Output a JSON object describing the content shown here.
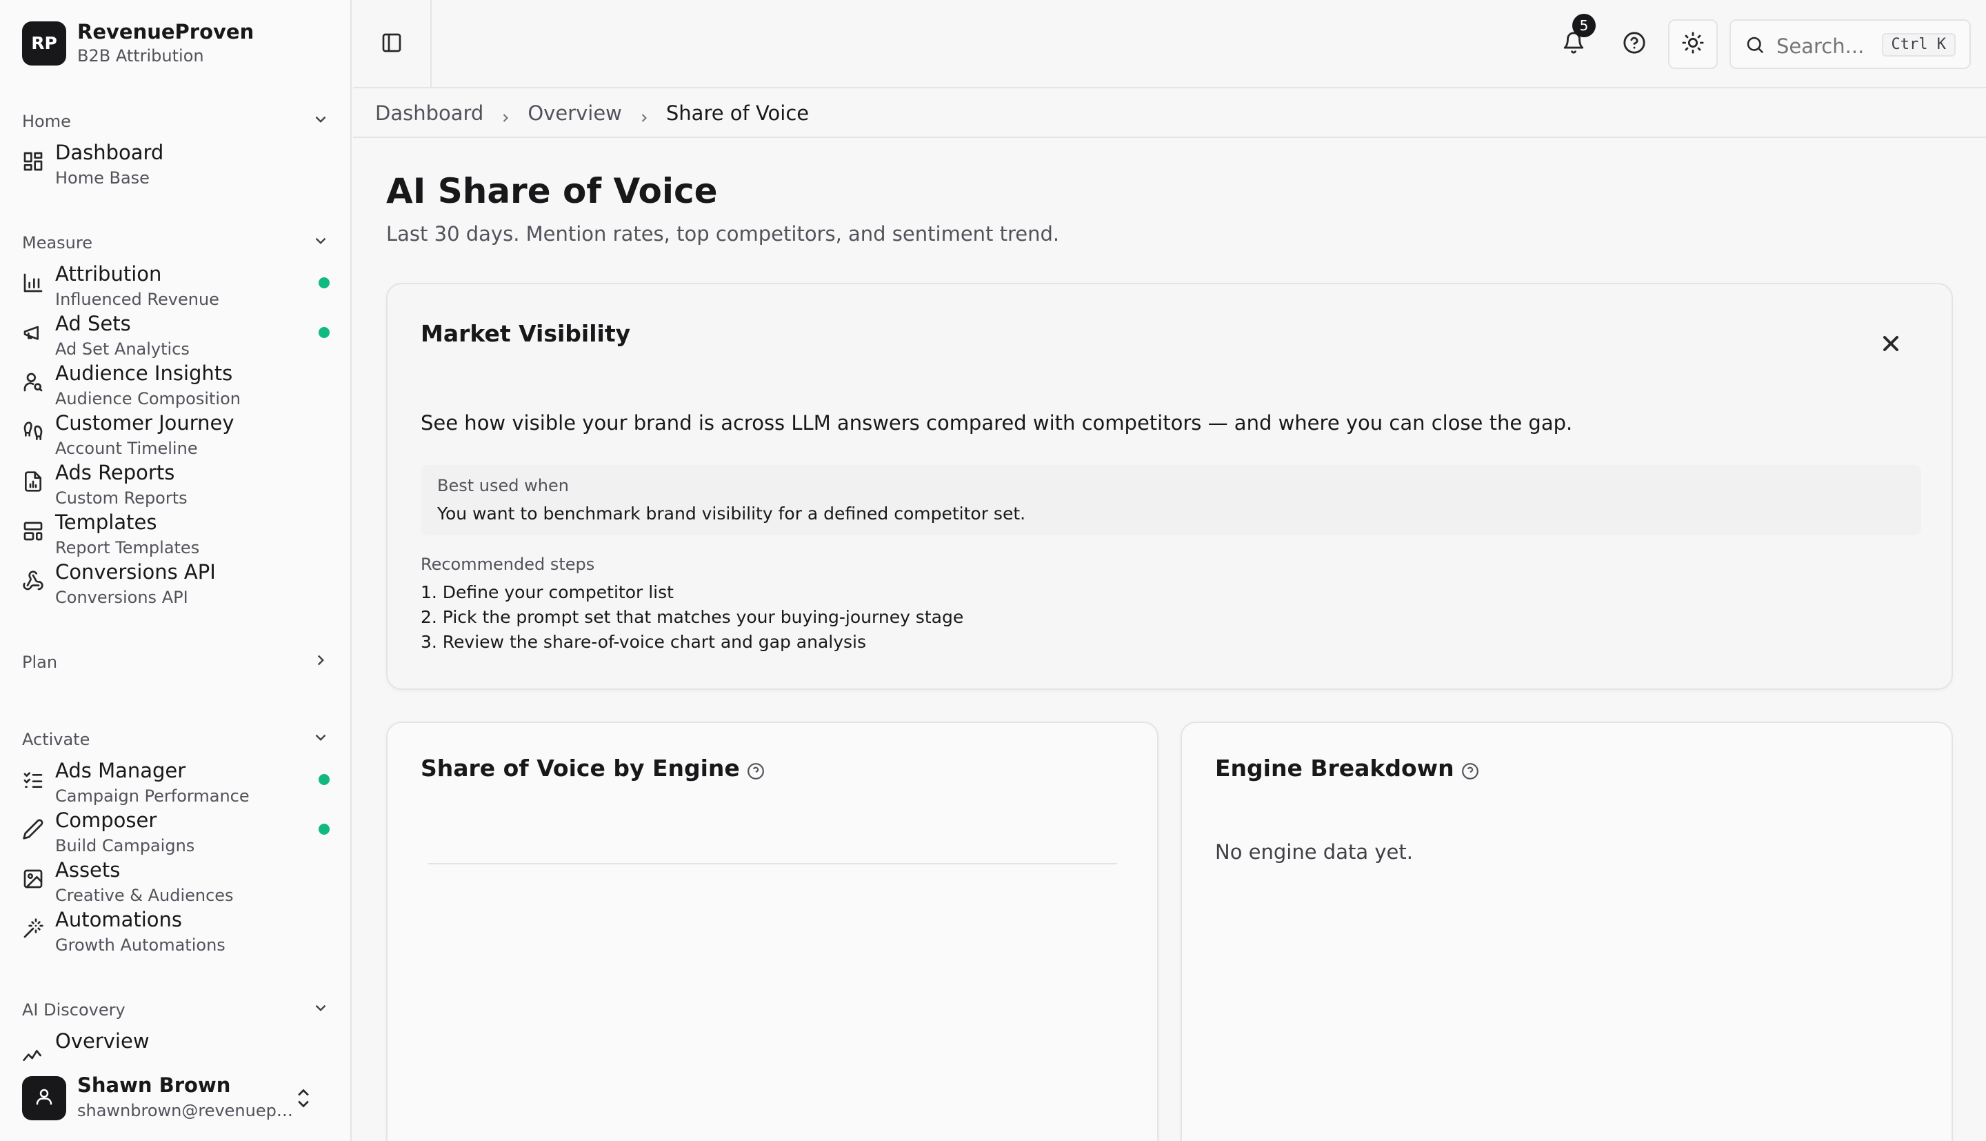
{
  "brand": {
    "logo_text": "RP",
    "name": "RevenueProven",
    "tagline": "B2B Attribution"
  },
  "sidebar": {
    "groups": [
      {
        "label": "Home",
        "expanded": true,
        "items": [
          {
            "title": "Dashboard",
            "subtitle": "Home Base",
            "icon": "grid-icon",
            "dot": false
          }
        ]
      },
      {
        "label": "Measure",
        "expanded": true,
        "items": [
          {
            "title": "Attribution",
            "subtitle": "Influenced Revenue",
            "icon": "bar-chart-icon",
            "dot": true
          },
          {
            "title": "Ad Sets",
            "subtitle": "Ad Set Analytics",
            "icon": "megaphone-icon",
            "dot": true
          },
          {
            "title": "Audience Insights",
            "subtitle": "Audience Composition",
            "icon": "user-search-icon",
            "dot": false
          },
          {
            "title": "Customer Journey",
            "subtitle": "Account Timeline",
            "icon": "footprints-icon",
            "dot": false
          },
          {
            "title": "Ads Reports",
            "subtitle": "Custom Reports",
            "icon": "report-file-icon",
            "dot": false
          },
          {
            "title": "Templates",
            "subtitle": "Report Templates",
            "icon": "layout-template-icon",
            "dot": false
          },
          {
            "title": "Conversions API",
            "subtitle": "Conversions API",
            "icon": "webhook-icon",
            "dot": false
          }
        ]
      },
      {
        "label": "Plan",
        "expanded": false,
        "items": []
      },
      {
        "label": "Activate",
        "expanded": true,
        "items": [
          {
            "title": "Ads Manager",
            "subtitle": "Campaign Performance",
            "icon": "list-checks-icon",
            "dot": true
          },
          {
            "title": "Composer",
            "subtitle": "Build Campaigns",
            "icon": "pen-icon",
            "dot": true
          },
          {
            "title": "Assets",
            "subtitle": "Creative & Audiences",
            "icon": "image-icon",
            "dot": false
          },
          {
            "title": "Automations",
            "subtitle": "Growth Automations",
            "icon": "magic-wand-icon",
            "dot": false
          }
        ]
      },
      {
        "label": "AI Discovery",
        "expanded": true,
        "items": [
          {
            "title": "Overview",
            "subtitle": "",
            "icon": "sparkline-icon",
            "dot": false
          }
        ]
      }
    ]
  },
  "user": {
    "name": "Shawn Brown",
    "email": "shawnbrown@revenueproven.com"
  },
  "topbar": {
    "notification_count": "5",
    "search_placeholder": "Search...",
    "search_shortcut": "Ctrl K"
  },
  "breadcrumb": [
    "Dashboard",
    "Overview",
    "Share of Voice"
  ],
  "page": {
    "title": "AI Share of Voice",
    "subtitle": "Last 30 days. Mention rates, top competitors, and sentiment trend."
  },
  "market_visibility": {
    "title": "Market Visibility",
    "description": "See how visible your brand is across LLM answers compared with competitors — and where you can close the gap.",
    "best_used_label": "Best used when",
    "best_used_text": "You want to benchmark brand visibility for a defined competitor set.",
    "recommended_label": "Recommended steps",
    "steps": [
      "1. Define your competitor list",
      "2. Pick the prompt set that matches your buying-journey stage",
      "3. Review the share-of-voice chart and gap analysis"
    ]
  },
  "share_of_voice_card": {
    "title": "Share of Voice by Engine"
  },
  "engine_breakdown_card": {
    "title": "Engine Breakdown",
    "empty_text": "No engine data yet."
  },
  "colors": {
    "accent_dot": "#10b981",
    "primary_dark": "#18181b"
  }
}
